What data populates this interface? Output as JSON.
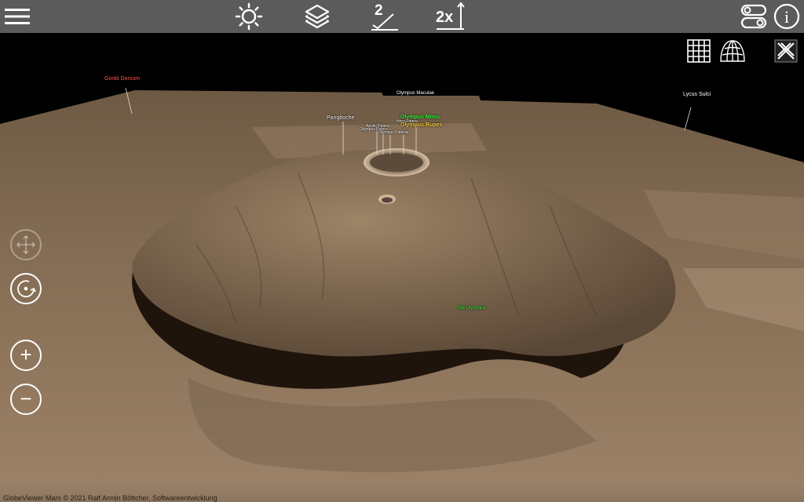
{
  "toolbar": {
    "menu_icon": "hamburger-menu-icon",
    "buttons": [
      {
        "name": "brightness-button",
        "icon": "sun-icon"
      },
      {
        "name": "layers-button",
        "icon": "layers-icon"
      },
      {
        "name": "elevation-button",
        "icon": "elevation-2-icon",
        "text": "2"
      },
      {
        "name": "zoom-2x-button",
        "icon": "zoom-2x-icon",
        "text": "2x"
      }
    ],
    "settings_icon": "toggle-switches-icon",
    "info_label": "i"
  },
  "view_controls": {
    "grid": "grid-icon",
    "globe_grid": "globe-grid-icon",
    "close_3d": "close-3d-icon"
  },
  "map_labels": {
    "gordii_dorsum": "Gordii Dorsum",
    "olympus_maculae": "Olympus Maculae",
    "lycus_sulci": "Lycus Sulci",
    "pangboche": "Pangboche",
    "olympus_mons": "Olympus Mons",
    "hera_patera": "Hera Patera",
    "olympus_rupes": "Olympus Rupes",
    "apollo_patera": "Apollo Patera",
    "olympus_patera": "Olympus Patera",
    "olympus_paterae": "Olympus Paterae",
    "nix_olympica": "Nix Olympica"
  },
  "left_controls": {
    "pan": "pan-arrows-icon",
    "rotate": "rotate-icon",
    "zoom_in": "+",
    "zoom_out": "−"
  },
  "footer": {
    "copyright": "GlobeViewer Mars © 2021 Ralf Armin Böttcher, Softwareentwicklung"
  },
  "colors": {
    "toolbar_bg": "#5b5b5b",
    "sky": "#000000",
    "terrain": "#8c7660",
    "label_green": "#3cff3c",
    "label_yellow": "#ffd23c",
    "label_red": "#ff5555"
  }
}
